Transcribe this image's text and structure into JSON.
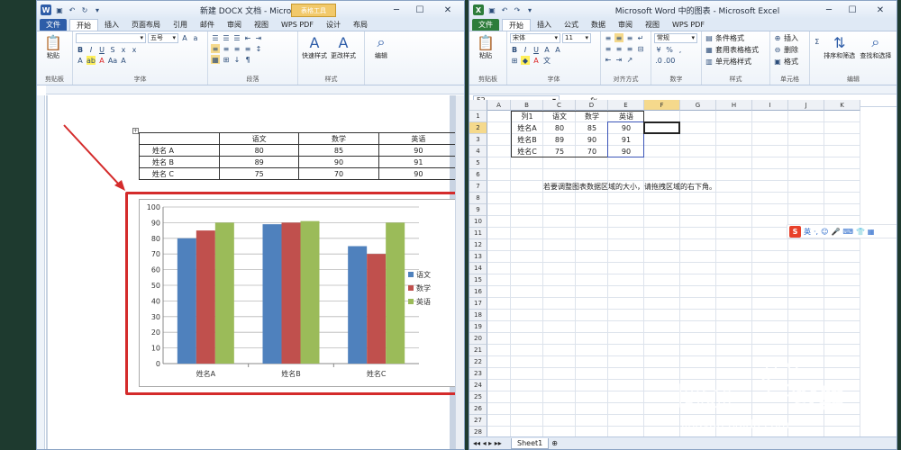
{
  "word": {
    "title": "新建 DOCX 文档 - Microsoft Word",
    "context_tab": "表格工具",
    "tabs": [
      "文件",
      "开始",
      "插入",
      "页面布局",
      "引用",
      "邮件",
      "审阅",
      "视图",
      "WPS PDF",
      "设计",
      "布局"
    ],
    "active_tab": "开始",
    "groups": [
      "剪贴板",
      "字体",
      "段落",
      "样式"
    ],
    "paste_label": "粘贴",
    "font_size": "五号",
    "quick_style_label": "快速样式",
    "change_style_label": "更改样式",
    "edit_label": "编辑",
    "table": {
      "headers": [
        "",
        "语文",
        "数学",
        "英语"
      ],
      "rows": [
        [
          "姓名 A",
          "80",
          "85",
          "90"
        ],
        [
          "姓名 B",
          "89",
          "90",
          "91"
        ],
        [
          "姓名 C",
          "75",
          "70",
          "90"
        ]
      ]
    }
  },
  "excel": {
    "title": "Microsoft Word 中的图表 - Microsoft Excel",
    "tabs": [
      "文件",
      "开始",
      "插入",
      "公式",
      "数据",
      "审阅",
      "视图",
      "WPS PDF"
    ],
    "active_tab": "开始",
    "groups": [
      "剪贴板",
      "字体",
      "对齐方式",
      "数字",
      "样式",
      "单元格",
      "编辑"
    ],
    "paste_label": "粘贴",
    "font_name": "宋体",
    "font_size": "11",
    "number_format": "常规",
    "style_items": [
      "条件格式",
      "套用表格格式",
      "单元格样式"
    ],
    "cell_items": [
      "插入",
      "删除",
      "格式"
    ],
    "sort_label": "排序和筛选",
    "find_label": "查找和选择",
    "name_box": "F2",
    "fx": "fx",
    "columns": [
      "A",
      "B",
      "C",
      "D",
      "E",
      "F",
      "G",
      "H",
      "I",
      "J",
      "K"
    ],
    "rows": [
      "1",
      "2",
      "3",
      "4",
      "5",
      "6",
      "7",
      "8",
      "9",
      "10",
      "11",
      "12",
      "13",
      "14",
      "15",
      "16",
      "17",
      "18",
      "19",
      "20",
      "21",
      "22",
      "23",
      "24",
      "25",
      "26",
      "27",
      "28"
    ],
    "data": [
      [
        "",
        "列1",
        "语文",
        "数学",
        "英语"
      ],
      [
        "",
        "姓名A",
        "80",
        "85",
        "90"
      ],
      [
        "",
        "姓名B",
        "89",
        "90",
        "91"
      ],
      [
        "",
        "姓名C",
        "75",
        "70",
        "90"
      ]
    ],
    "note": "若要调整图表数据区域的大小，请拖拽区域的右下角。",
    "sheet_tab": "Sheet1",
    "ime_label": "英"
  },
  "chart_data": {
    "type": "bar",
    "categories": [
      "姓名A",
      "姓名B",
      "姓名C"
    ],
    "series": [
      {
        "name": "语文",
        "values": [
          80,
          89,
          75
        ],
        "color": "#4f81bd"
      },
      {
        "name": "数学",
        "values": [
          85,
          90,
          70
        ],
        "color": "#c0504d"
      },
      {
        "name": "英语",
        "values": [
          90,
          91,
          90
        ],
        "color": "#9bbb59"
      }
    ],
    "ylim": [
      0,
      100
    ],
    "yticks": [
      "0",
      "10",
      "20",
      "30",
      "40",
      "50",
      "60",
      "70",
      "80",
      "90",
      "100"
    ],
    "grid": true,
    "legend": "right"
  },
  "watermark": {
    "brand": "Bai",
    "brand_suffix": "经验",
    "url": "jingyan.baidu.com"
  }
}
